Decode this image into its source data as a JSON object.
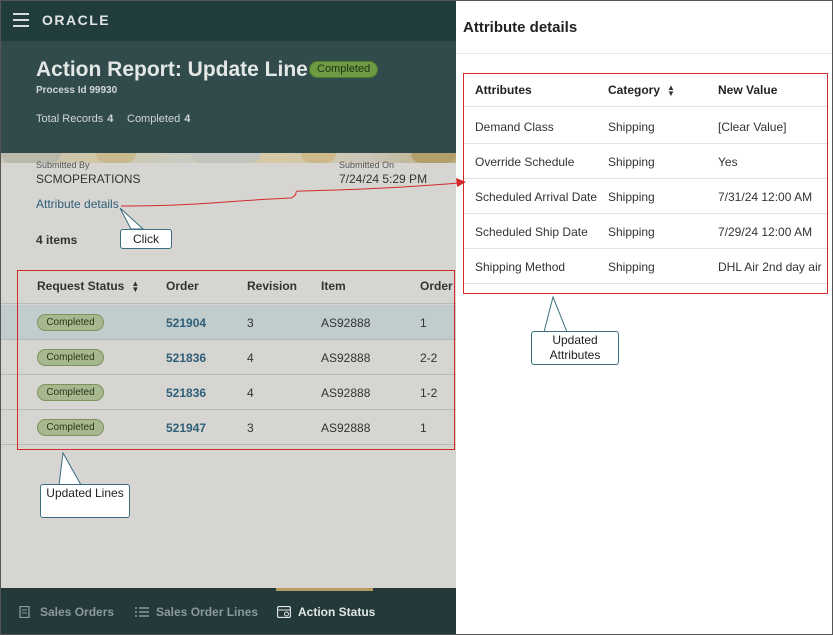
{
  "app": {
    "logo": "ORACLE"
  },
  "report": {
    "title": "Action Report: Update Line",
    "status": "Completed",
    "process_id": "Process Id 99930",
    "total_records_label": "Total Records",
    "total_records_value": "4",
    "completed_label": "Completed",
    "completed_value": "4",
    "submitted_by_label": "Submitted By",
    "submitted_by_value": "SCMOPERATIONS",
    "submitted_on_label": "Submitted On",
    "submitted_on_value": "7/24/24 5:29 PM",
    "attribute_details_link": "Attribute details",
    "items_count": "4 items"
  },
  "lines_table": {
    "headers": [
      "Request Status",
      "Order",
      "Revision",
      "Item",
      "Order"
    ],
    "rows": [
      {
        "status": "Completed",
        "order": "521904",
        "revision": "3",
        "item": "AS92888",
        "order_line": "1",
        "selected": true
      },
      {
        "status": "Completed",
        "order": "521836",
        "revision": "4",
        "item": "AS92888",
        "order_line": "2-2",
        "selected": false
      },
      {
        "status": "Completed",
        "order": "521836",
        "revision": "4",
        "item": "AS92888",
        "order_line": "1-2",
        "selected": false
      },
      {
        "status": "Completed",
        "order": "521947",
        "revision": "3",
        "item": "AS92888",
        "order_line": "1",
        "selected": false
      }
    ]
  },
  "bottom_nav": {
    "items": [
      {
        "label": "Sales Orders",
        "icon": "document-icon",
        "active": false
      },
      {
        "label": "Sales Order Lines",
        "icon": "list-icon",
        "active": false
      },
      {
        "label": "Action Status",
        "icon": "status-icon",
        "active": true
      }
    ]
  },
  "drawer": {
    "title": "Attribute details",
    "headers": [
      "Attributes",
      "Category",
      "New Value"
    ],
    "rows": [
      {
        "attribute": "Demand Class",
        "category": "Shipping",
        "new_value": "[Clear Value]"
      },
      {
        "attribute": "Override Schedule",
        "category": "Shipping",
        "new_value": "Yes"
      },
      {
        "attribute": "Scheduled Arrival Date",
        "category": "Shipping",
        "new_value": "7/31/24 12:00 AM"
      },
      {
        "attribute": "Scheduled Ship Date",
        "category": "Shipping",
        "new_value": "7/29/24 12:00 AM"
      },
      {
        "attribute": "Shipping Method",
        "category": "Shipping",
        "new_value": "DHL Air 2nd day air"
      }
    ]
  },
  "callouts": {
    "click": "Click",
    "updated_attributes": "Updated Attributes",
    "updated_lines": "Updated Lines"
  },
  "colors": {
    "header_bg": "#314a4b",
    "topbar_bg": "#203c3c",
    "nav_bg": "#24393a",
    "completed_pill": "#a7b88f",
    "link": "#2f5f78",
    "annotation_red": "#d42a2a",
    "callout_border": "#3b6e80"
  }
}
